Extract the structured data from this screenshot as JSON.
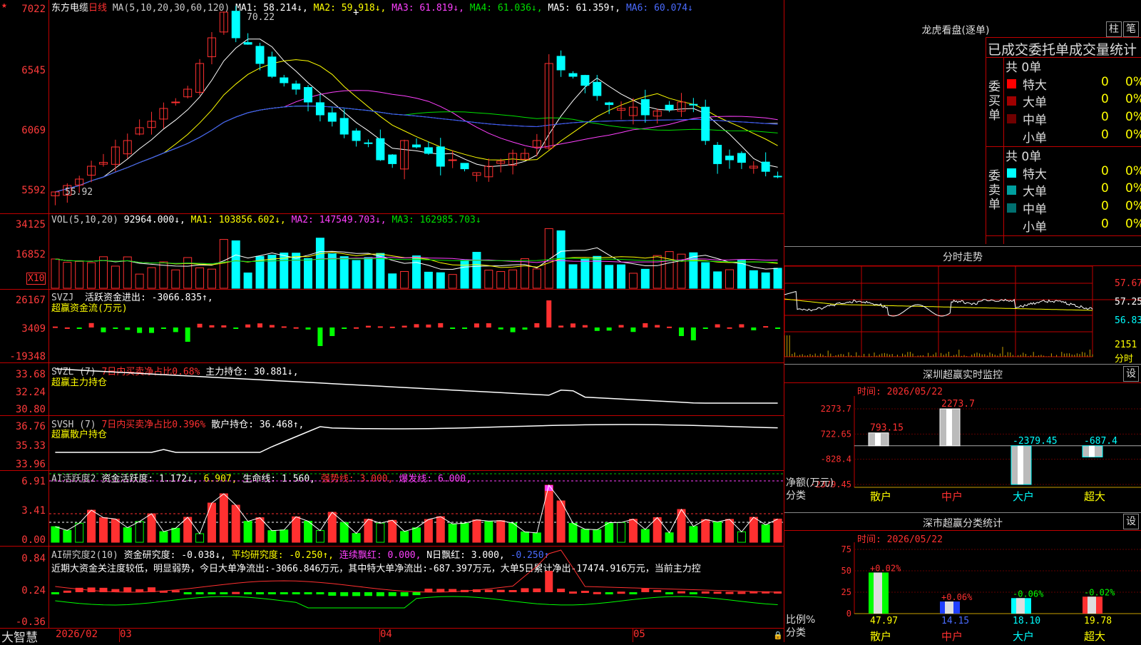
{
  "stock": {
    "name": "东方电缆",
    "period": "日线",
    "star": "★"
  },
  "kline": {
    "legend_ma": "MA(5,10,20,30,60,120)",
    "ma1": "MA1: 58.214↓,",
    "ma2": "MA2: 59.918↓,",
    "ma3": "MA3: 61.819↓,",
    "ma4": "MA4: 61.036↓,",
    "ma5": "MA5: 61.359↑,",
    "ma6": "MA6: 60.074↓",
    "high_label": "70.22",
    "low_label": "55.92",
    "y_labels": [
      "7022",
      "6545",
      "6069",
      "5592"
    ]
  },
  "vol": {
    "legend": "VOL(5,10,20)",
    "value": "92964.000↓,",
    "ma1": "MA1: 103856.602↓,",
    "ma2": "MA2: 147549.703↓,",
    "ma3": "MA3: 162985.703↓",
    "y_labels": [
      "34125",
      "16852"
    ],
    "unit": "X10"
  },
  "svzj": {
    "legend": "SVZJ",
    "label": "活跃资金进出: -3066.835↑,",
    "sub": "超赢资金流(万元)",
    "y_labels": [
      "26167",
      "3409",
      "-19348"
    ]
  },
  "svzl": {
    "legend": "SVZL (7)",
    "ratio": "7日内买卖净占比0.68%",
    "main": "主力持仓: 30.881↓,",
    "sub": "超赢主力持仓",
    "y_labels": [
      "33.68",
      "32.24",
      "30.80"
    ]
  },
  "svsh": {
    "legend": "SVSH (7)",
    "ratio": "7日内买卖净占比0.396%",
    "retail": "散户持仓: 36.468↑,",
    "sub": "超赢散户持仓",
    "y_labels": [
      "36.76",
      "35.33",
      "33.96"
    ]
  },
  "ai1": {
    "legend": "AI活跃度2",
    "act": "资金活跃度: 1.172↓,",
    "val2": "6.907,",
    "life": "生命线: 1.560,",
    "strong": "强势线: 3.000,",
    "burst": "爆发线: 6.000,",
    "y_labels": [
      "6.91",
      "3.41",
      "0.00"
    ]
  },
  "ai2": {
    "legend": "AI研究度2(10)",
    "research": "资金研究度: -0.038↓,",
    "avg": "平均研究度: -0.250↑,",
    "cont": "连续飘红: 0.000,",
    "nday": "N日飘红: 3.000,",
    "last": "-0.250↑",
    "comment": "近期大资金关注度较低，明显弱势，今日大单净流出:-3066.846万元，其中特大单净流出:-687.397万元，大单5日累计净出-17474.916万元，当前主力控",
    "y_labels": [
      "0.84",
      "0.24",
      "-0.36"
    ]
  },
  "bottom": {
    "brand": "大智慧",
    "dates": [
      "2026/02",
      "03",
      "04",
      "05"
    ]
  },
  "lhb": {
    "title": "龙虎看盘(逐单)",
    "btn1": "柱",
    "btn2": "笔",
    "header": "已成交委托单成交量统计",
    "buy_label": "委买单",
    "sell_label": "委卖单",
    "buy_total": "共 0单",
    "sell_total": "共 0单",
    "buy_rows": [
      {
        "name": "特大",
        "v1": "0",
        "v2": "0%",
        "color": "#ff0000"
      },
      {
        "name": "大单",
        "v1": "0",
        "v2": "0%",
        "color": "#a00000"
      },
      {
        "name": "中单",
        "v1": "0",
        "v2": "0%",
        "color": "#700000"
      },
      {
        "name": "小单",
        "v1": "0",
        "v2": "0%",
        "color": ""
      }
    ],
    "sell_rows": [
      {
        "name": "特大",
        "v1": "0",
        "v2": "0%",
        "color": "#00ffff"
      },
      {
        "name": "大单",
        "v1": "0",
        "v2": "0%",
        "color": "#00a0a0"
      },
      {
        "name": "中单",
        "v1": "0",
        "v2": "0%",
        "color": "#007070"
      },
      {
        "name": "小单",
        "v1": "0",
        "v2": "0%",
        "color": ""
      }
    ]
  },
  "intraday": {
    "title": "分时走势",
    "y_labels": [
      "57.67",
      "57.25",
      "56.83"
    ],
    "vol_label": "2151",
    "vol_unit": "分时"
  },
  "monitor": {
    "title": "深圳超赢实时监控",
    "btn": "设",
    "time": "时间: 2026/05/22",
    "y_labels": [
      "2273.7",
      "722.65",
      "-828.4",
      "-2379.45"
    ],
    "y_unit": "净额(万元)",
    "x_unit": "分类",
    "categories": [
      "散户",
      "中户",
      "大户",
      "超大"
    ],
    "values": [
      793.15,
      2273.7,
      -2379.45,
      -687.4
    ],
    "value_labels": [
      "793.15",
      "2273.7",
      "-2379.45",
      "-687.4"
    ]
  },
  "classify": {
    "title": "深市超赢分类统计",
    "btn": "设",
    "time": "时间: 2026/05/22",
    "y_labels": [
      "75",
      "50",
      "25",
      "0"
    ],
    "y_unit": "比例%",
    "x_unit": "分类",
    "categories": [
      "散户",
      "中户",
      "大户",
      "超大"
    ],
    "values": [
      47.97,
      14.15,
      18.1,
      19.78
    ],
    "value_labels": [
      "47.97",
      "14.15",
      "18.10",
      "19.78"
    ],
    "change_labels": [
      "+0.02%",
      "+0.06%",
      "-0.06%",
      "-0.02%"
    ]
  }
}
